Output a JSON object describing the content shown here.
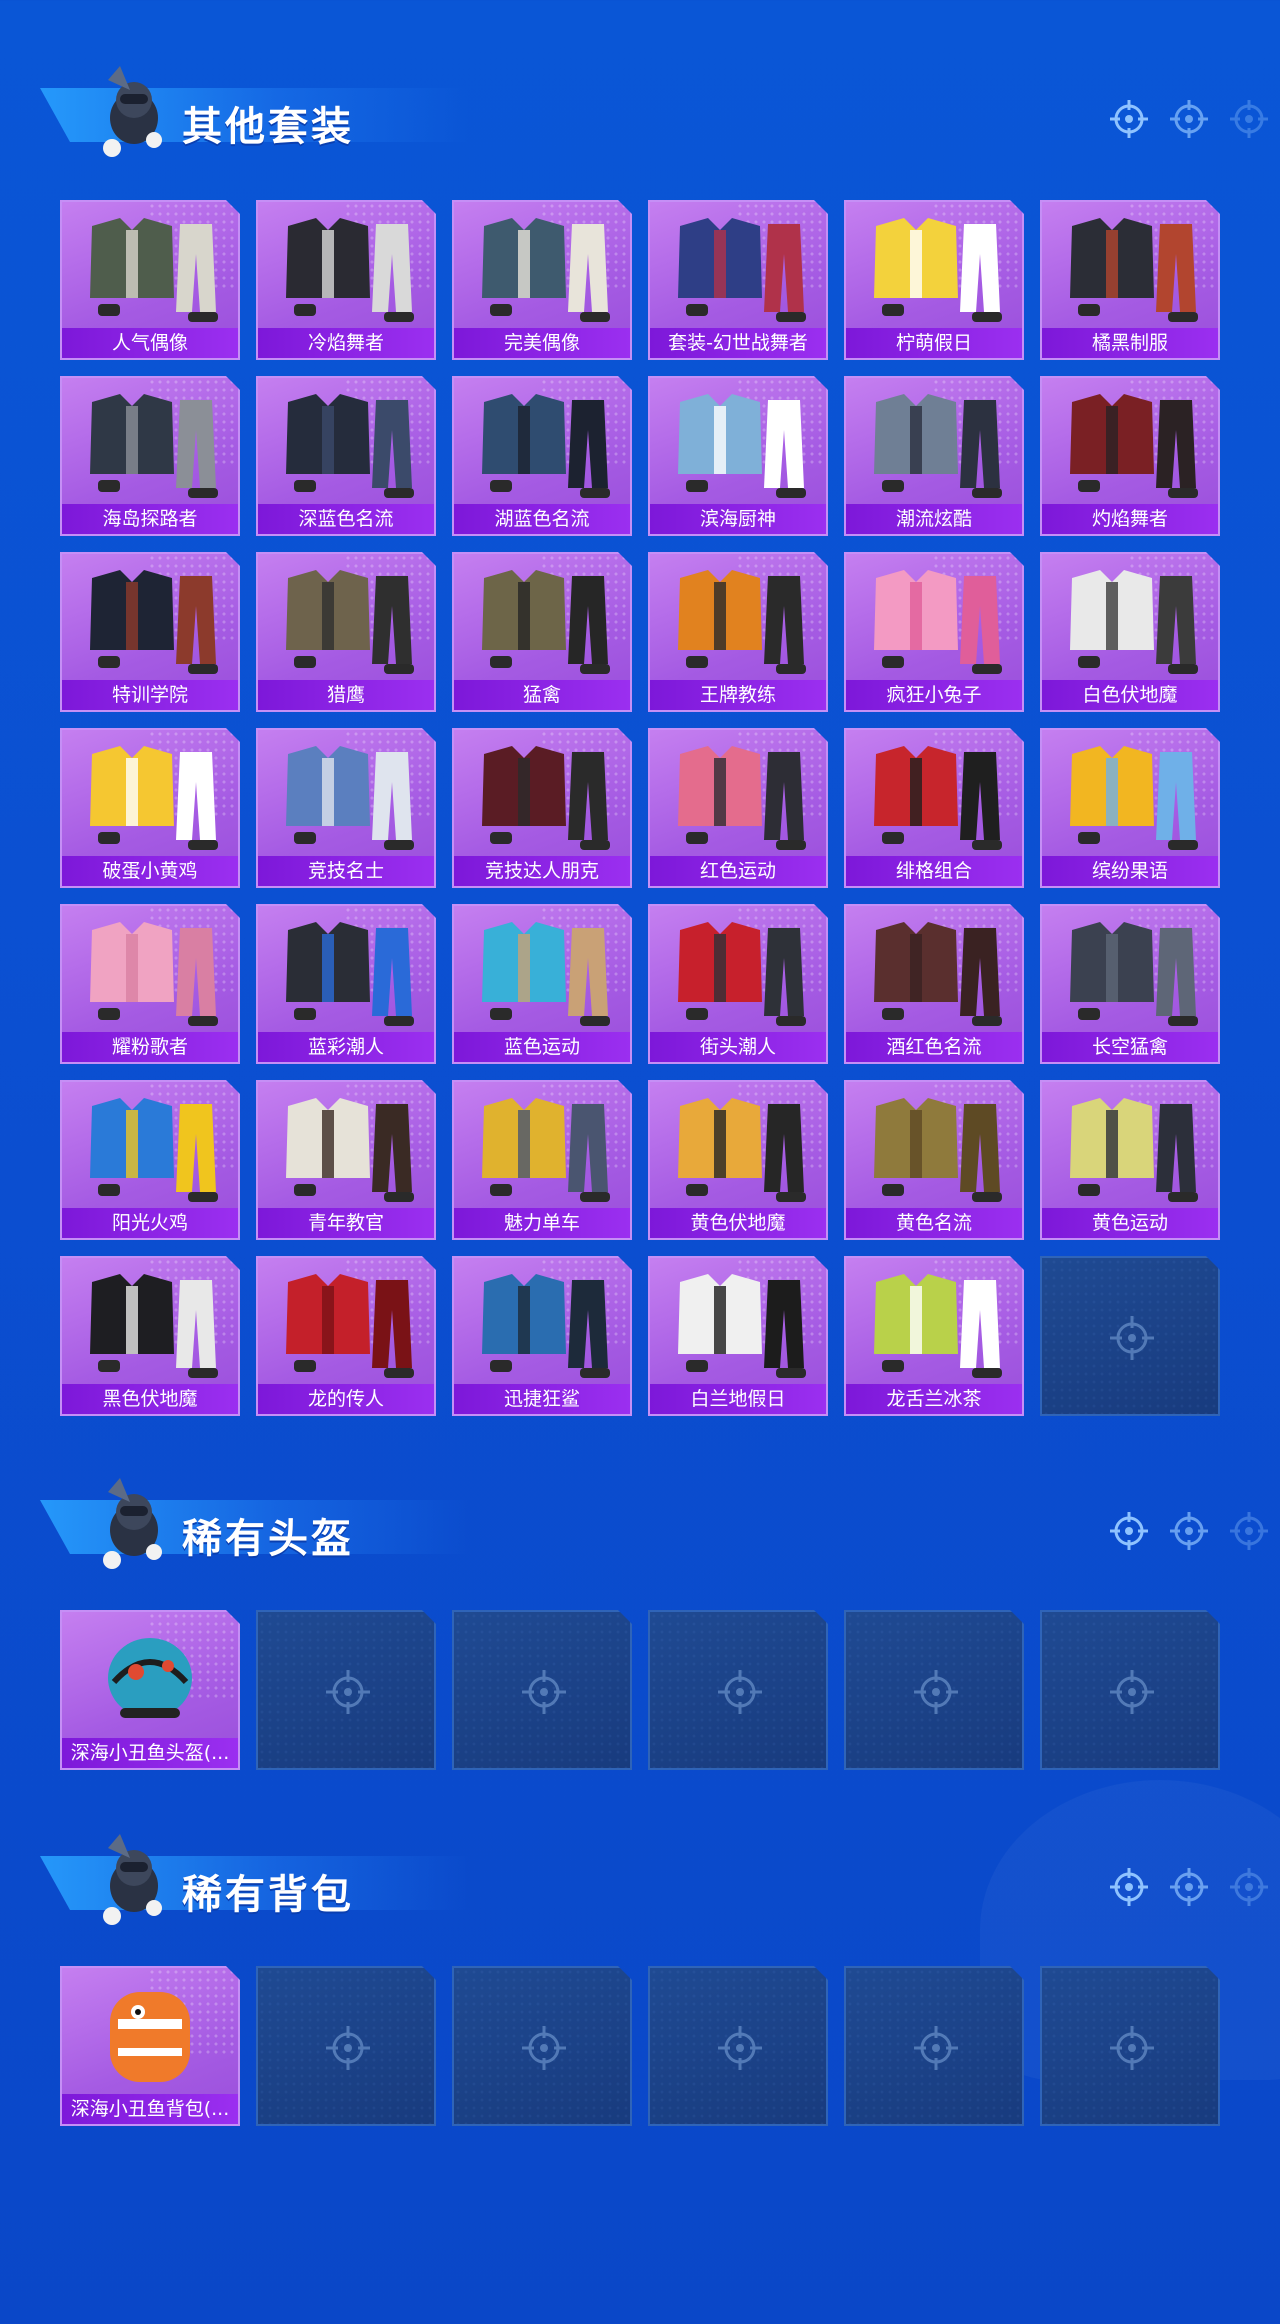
{
  "colors": {
    "background": "#0b4fd1",
    "card_purple": "#a55be3",
    "label_bar": "#8a22e6",
    "empty_slot": "#1c4488"
  },
  "sections": [
    {
      "title": "其他套装",
      "items": [
        {
          "label": "人气偶像",
          "palette": [
            "#4f5d4c",
            "#d8d6cc"
          ]
        },
        {
          "label": "冷焰舞者",
          "palette": [
            "#2a2a32",
            "#d9d9d9"
          ]
        },
        {
          "label": "完美偶像",
          "palette": [
            "#3e5a6e",
            "#e8e4da"
          ]
        },
        {
          "label": "套装-幻世战舞者",
          "palette": [
            "#2e3e86",
            "#b0324a"
          ]
        },
        {
          "label": "柠萌假日",
          "palette": [
            "#f3d23c",
            "#ffffff"
          ]
        },
        {
          "label": "橘黑制服",
          "palette": [
            "#2b2d36",
            "#b2452f"
          ]
        },
        {
          "label": "海岛探路者",
          "palette": [
            "#2f3846",
            "#8b8f97"
          ]
        },
        {
          "label": "深蓝色名流",
          "palette": [
            "#252c3c",
            "#3b4a6a"
          ]
        },
        {
          "label": "湖蓝色名流",
          "palette": [
            "#2f4c70",
            "#1c2230"
          ]
        },
        {
          "label": "滨海厨神",
          "palette": [
            "#7fb0d8",
            "#ffffff"
          ]
        },
        {
          "label": "潮流炫酷",
          "palette": [
            "#6f7f95",
            "#2c3140"
          ]
        },
        {
          "label": "灼焰舞者",
          "palette": [
            "#7a2024",
            "#2b2224"
          ]
        },
        {
          "label": "特训学院",
          "palette": [
            "#1e2434",
            "#8c3a2c"
          ]
        },
        {
          "label": "猎鹰",
          "palette": [
            "#6e634c",
            "#2f2f2f"
          ]
        },
        {
          "label": "猛禽",
          "palette": [
            "#6d6548",
            "#262626"
          ]
        },
        {
          "label": "王牌教练",
          "palette": [
            "#e1821f",
            "#2a2a2a"
          ]
        },
        {
          "label": "疯狂小兔子",
          "palette": [
            "#f39ac3",
            "#e05e9a"
          ]
        },
        {
          "label": "白色伏地魔",
          "palette": [
            "#e9e9e9",
            "#3b3b3b"
          ]
        },
        {
          "label": "破蛋小黄鸡",
          "palette": [
            "#f5c731",
            "#ffffff"
          ]
        },
        {
          "label": "竞技名士",
          "palette": [
            "#5b7fbf",
            "#dfe4ee"
          ]
        },
        {
          "label": "竞技达人朋克",
          "palette": [
            "#5a1c24",
            "#2a2a2a"
          ]
        },
        {
          "label": "红色运动",
          "palette": [
            "#e46c8d",
            "#2d2d35"
          ]
        },
        {
          "label": "绯格组合",
          "palette": [
            "#c7252c",
            "#1f1f1f"
          ]
        },
        {
          "label": "缤纷果语",
          "palette": [
            "#f2b621",
            "#6fb0e8"
          ]
        },
        {
          "label": "耀粉歌者",
          "palette": [
            "#f0a3c2",
            "#d97fa3"
          ]
        },
        {
          "label": "蓝彩潮人",
          "palette": [
            "#2a2d36",
            "#2a6ad8"
          ]
        },
        {
          "label": "蓝色运动",
          "palette": [
            "#38b0d8",
            "#c9a176"
          ]
        },
        {
          "label": "街头潮人",
          "palette": [
            "#c7202c",
            "#2e3138"
          ]
        },
        {
          "label": "酒红色名流",
          "palette": [
            "#5a2f2e",
            "#3a2222"
          ]
        },
        {
          "label": "长空猛禽",
          "palette": [
            "#3b4150",
            "#5e6677"
          ]
        },
        {
          "label": "阳光火鸡",
          "palette": [
            "#2a7ad8",
            "#f0c51e"
          ]
        },
        {
          "label": "青年教官",
          "palette": [
            "#e6e2d8",
            "#3a2a24"
          ]
        },
        {
          "label": "魅力单车",
          "palette": [
            "#e0b22e",
            "#4a5570"
          ]
        },
        {
          "label": "黄色伏地魔",
          "palette": [
            "#e8a93a",
            "#262626"
          ]
        },
        {
          "label": "黄色名流",
          "palette": [
            "#8f7a3c",
            "#5e4a24"
          ]
        },
        {
          "label": "黄色运动",
          "palette": [
            "#d9d57a",
            "#2c2f3a"
          ]
        },
        {
          "label": "黑色伏地魔",
          "palette": [
            "#1e1e22",
            "#e8e8e8"
          ]
        },
        {
          "label": "龙的传人",
          "palette": [
            "#c4202a",
            "#7a1216"
          ]
        },
        {
          "label": "迅捷狂鲨",
          "palette": [
            "#2a6db0",
            "#1d2a3a"
          ]
        },
        {
          "label": "白兰地假日",
          "palette": [
            "#f0f0f0",
            "#1c1c1c"
          ]
        },
        {
          "label": "龙舌兰冰茶",
          "palette": [
            "#b9d14a",
            "#ffffff"
          ]
        }
      ],
      "empty_count": 1
    },
    {
      "title": "稀有头盔",
      "items": [
        {
          "label": "深海小丑鱼头盔(...",
          "palette": [
            "#2a9ec0",
            "#e04a32"
          ]
        }
      ],
      "empty_count": 5
    },
    {
      "title": "稀有背包",
      "items": [
        {
          "label": "深海小丑鱼背包(...",
          "palette": [
            "#f07a2a",
            "#ffffff"
          ]
        }
      ],
      "empty_count": 5
    }
  ]
}
